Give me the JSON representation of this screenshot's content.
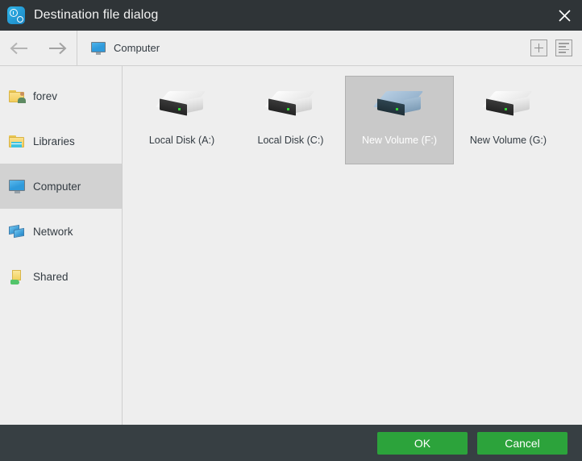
{
  "window": {
    "title": "Destination file dialog",
    "app_icon": "clock-gear-icon",
    "close_icon": "close-icon"
  },
  "toolbar": {
    "back_icon": "arrow-left-icon",
    "forward_icon": "arrow-right-icon",
    "breadcrumb": {
      "icon": "computer-monitor-icon",
      "label": "Computer"
    },
    "new_folder_icon": "plus-square-icon",
    "view_list_icon": "list-view-icon"
  },
  "sidebar": {
    "items": [
      {
        "label": "forev",
        "icon": "user-folder-icon",
        "selected": false
      },
      {
        "label": "Libraries",
        "icon": "libraries-folder-icon",
        "selected": false
      },
      {
        "label": "Computer",
        "icon": "computer-monitor-icon",
        "selected": true
      },
      {
        "label": "Network",
        "icon": "network-icon",
        "selected": false
      },
      {
        "label": "Shared",
        "icon": "shared-folder-icon",
        "selected": false
      }
    ]
  },
  "content": {
    "drives": [
      {
        "label": "Local Disk (A:)",
        "icon": "hard-drive-icon",
        "selected": false
      },
      {
        "label": "Local Disk (C:)",
        "icon": "hard-drive-icon",
        "selected": false
      },
      {
        "label": "New Volume (F:)",
        "icon": "hard-drive-icon",
        "selected": true
      },
      {
        "label": "New Volume (G:)",
        "icon": "hard-drive-icon",
        "selected": false
      }
    ]
  },
  "footer": {
    "ok_label": "OK",
    "cancel_label": "Cancel"
  },
  "colors": {
    "titlebar": "#2f3437",
    "footer": "#373f43",
    "accent_green": "#2ca33b",
    "selection_grey": "#c9c9c9",
    "sidebar_selection": "#d2d2d2",
    "panel_grey": "#eeeeee"
  }
}
